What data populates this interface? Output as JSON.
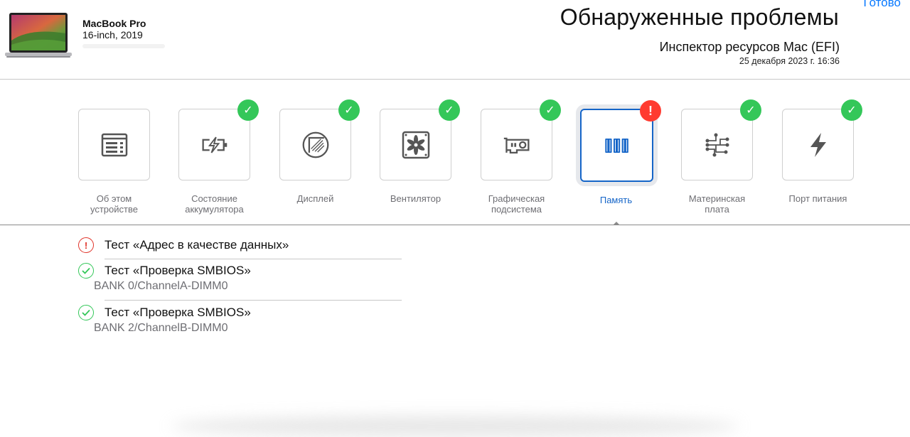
{
  "header": {
    "device_name": "MacBook Pro",
    "device_model": "16-inch, 2019",
    "title": "Обнаруженные проблемы",
    "done_label": "Готово",
    "subtitle": "Инспектор ресурсов Mac (EFI)",
    "timestamp": "25 декабря 2023 г. 16:36"
  },
  "categories": [
    {
      "label": "Об этом устройстве",
      "icon": "info-panel-icon",
      "status": "none"
    },
    {
      "label": "Состояние аккумулятора",
      "icon": "battery-icon",
      "status": "ok"
    },
    {
      "label": "Дисплей",
      "icon": "display-icon",
      "status": "ok"
    },
    {
      "label": "Вентилятор",
      "icon": "fan-icon",
      "status": "ok"
    },
    {
      "label": "Графическая подсистема",
      "icon": "graphics-card-icon",
      "status": "ok"
    },
    {
      "label": "Память",
      "icon": "memory-icon",
      "status": "error",
      "selected": true
    },
    {
      "label": "Материнская плата",
      "icon": "motherboard-icon",
      "status": "ok"
    },
    {
      "label": "Порт питания",
      "icon": "power-port-icon",
      "status": "ok"
    }
  ],
  "badges": {
    "ok_symbol": "✓",
    "error_symbol": "!"
  },
  "tests": [
    {
      "name": "Тест «Адрес в качестве данных»",
      "detail": "",
      "status": "error"
    },
    {
      "name": "Тест «Проверка SMBIOS»",
      "detail": "BANK 0/ChannelA-DIMM0",
      "status": "ok"
    },
    {
      "name": "Тест «Проверка SMBIOS»",
      "detail": "BANK 2/ChannelB-DIMM0",
      "status": "ok"
    }
  ],
  "colors": {
    "accent": "#1565c8",
    "ok": "#34c759",
    "error": "#ff3b30",
    "link": "#0a7aff"
  }
}
